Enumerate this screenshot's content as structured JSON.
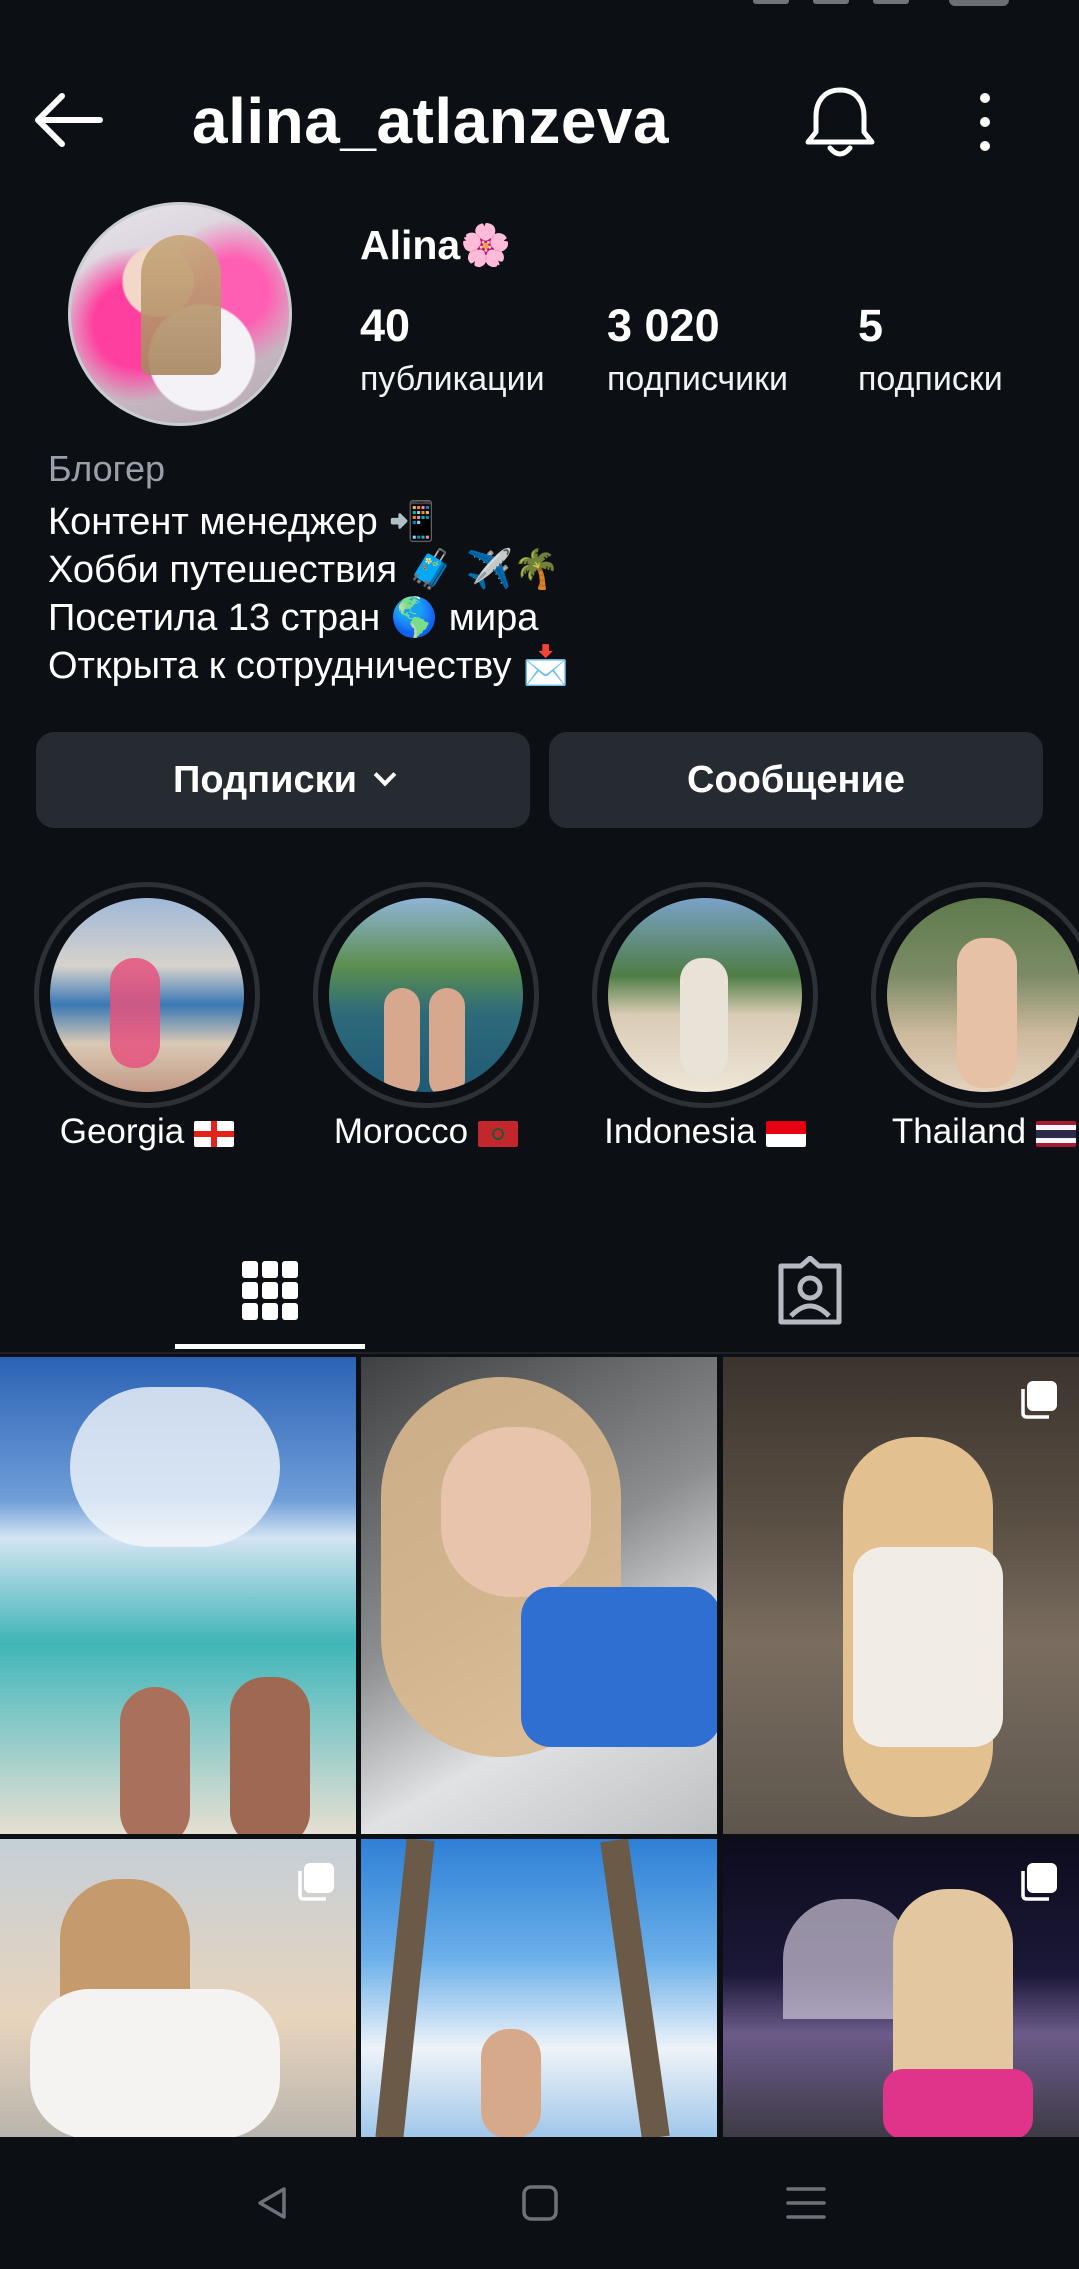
{
  "header": {
    "username": "alina_atlanzeva"
  },
  "profile": {
    "display_name": "Alina🌸",
    "stats": [
      {
        "value": "40",
        "label": "публикации"
      },
      {
        "value": "3 020",
        "label": "подписчики"
      },
      {
        "value": "5",
        "label": "подписки"
      }
    ],
    "bio": {
      "category": "Блогер",
      "lines": [
        "Контент менеджер 📲",
        "Хобби путешествия 🧳 ✈️🌴",
        "Посетила 13 стран 🌎 мира",
        "Открыта к сотрудничеству 📩"
      ]
    }
  },
  "actions": {
    "following_label": "Подписки",
    "message_label": "Сообщение"
  },
  "highlights": [
    {
      "label": "Georgia"
    },
    {
      "label": "Morocco"
    },
    {
      "label": "Indonesia"
    },
    {
      "label": "Thailand"
    }
  ],
  "tabs": {
    "grid": "grid-icon",
    "tagged": "tagged-icon"
  },
  "posts": [
    {
      "index": 1,
      "multi": false
    },
    {
      "index": 2,
      "multi": false
    },
    {
      "index": 3,
      "multi": true
    },
    {
      "index": 4,
      "multi": true
    },
    {
      "index": 5,
      "multi": false
    },
    {
      "index": 6,
      "multi": true
    }
  ],
  "colors": {
    "background": "#0c0f14",
    "button_bg": "#262a31",
    "secondary_text": "#9aa0a8"
  }
}
